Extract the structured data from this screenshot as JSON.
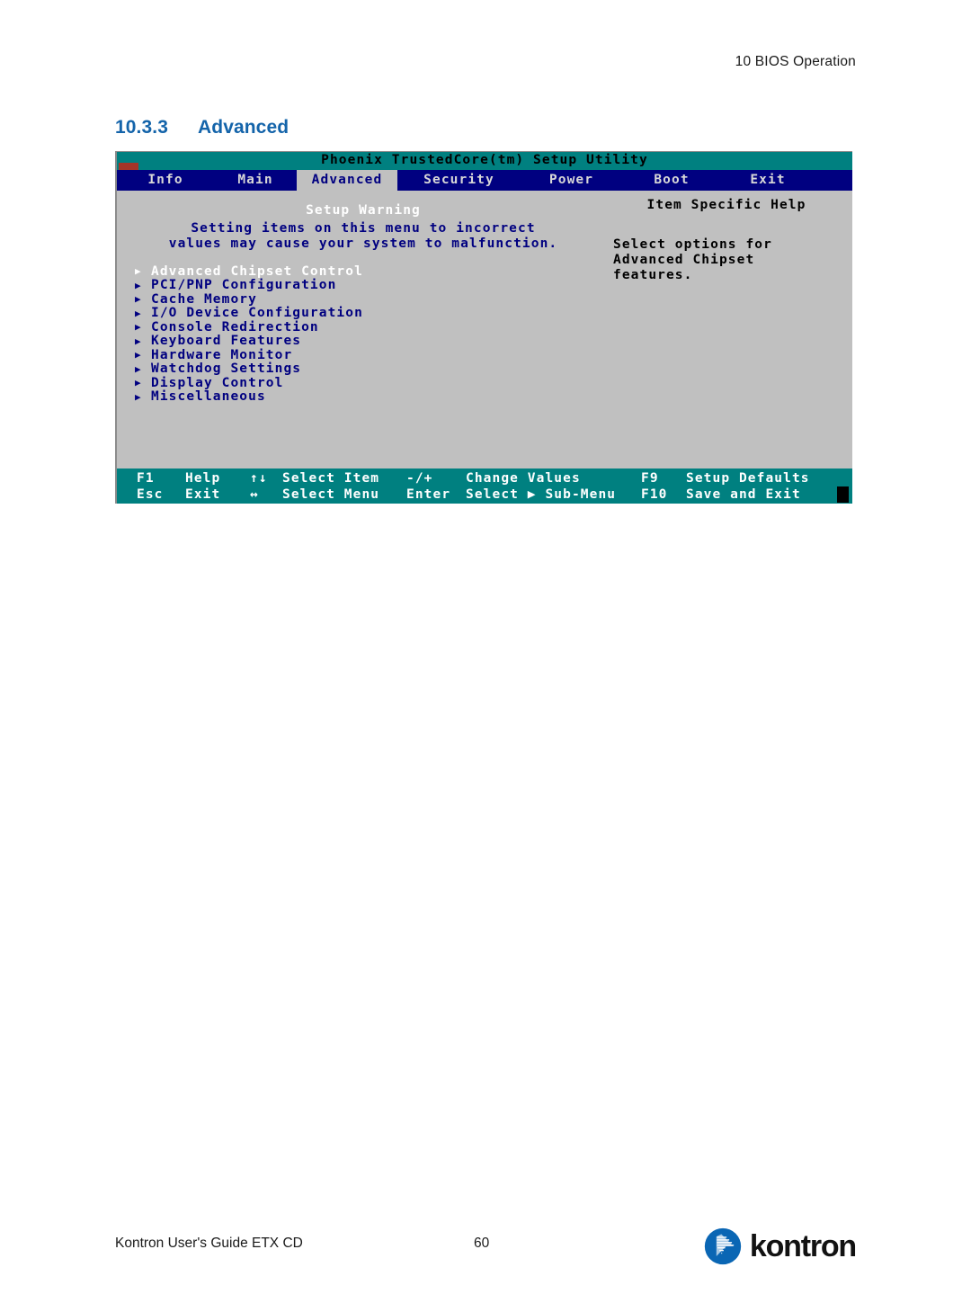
{
  "page": {
    "header": "10 BIOS Operation",
    "heading_number": "10.3.3",
    "heading_title": "Advanced",
    "footer_left": "Kontron User's Guide ETX CD",
    "footer_page": "60",
    "logo_word": "kontron",
    "colors": {
      "heading_blue": "#1464aa",
      "logo_blue": "#0a66b4",
      "bios_titlebar_teal": "#008080",
      "bios_menubar_blue": "#000080",
      "bios_background_gray": "#c0c0c0",
      "bios_text_blue": "#000080",
      "bios_selected_white": "#ffffff",
      "title_redmark": "#a33528"
    }
  },
  "bios": {
    "title": "Phoenix TrustedCore(tm) Setup Utility",
    "menubar": [
      {
        "label": "Info",
        "active": false
      },
      {
        "label": "Main",
        "active": false
      },
      {
        "label": "Advanced",
        "active": true
      },
      {
        "label": "Security",
        "active": false
      },
      {
        "label": "Power",
        "active": false
      },
      {
        "label": "Boot",
        "active": false
      },
      {
        "label": "Exit",
        "active": false
      }
    ],
    "warning": {
      "title": "Setup Warning",
      "line1": "Setting items on this menu to incorrect",
      "line2": "values may cause your system to malfunction."
    },
    "items": [
      {
        "label": "Advanced Chipset Control",
        "selected": true
      },
      {
        "label": "PCI/PNP Configuration",
        "selected": false
      },
      {
        "label": "Cache Memory",
        "selected": false
      },
      {
        "label": "I/O Device Configuration",
        "selected": false
      },
      {
        "label": "Console Redirection",
        "selected": false
      },
      {
        "label": "Keyboard Features",
        "selected": false
      },
      {
        "label": "Hardware Monitor",
        "selected": false
      },
      {
        "label": "Watchdog Settings",
        "selected": false
      },
      {
        "label": "Display Control",
        "selected": false
      },
      {
        "label": "Miscellaneous",
        "selected": false
      }
    ],
    "item_arrow": "▶",
    "help": {
      "title": "Item Specific Help",
      "line1": "Select options for",
      "line2": "Advanced Chipset",
      "line3": "features."
    },
    "status": {
      "row1": {
        "key1": "F1",
        "action1": "Help",
        "key2": "↑↓",
        "action2": "Select Item",
        "key3": "-/+",
        "action3": "Change Values",
        "key4": "F9",
        "action4": "Setup Defaults"
      },
      "row2": {
        "key1": "Esc",
        "action1": "Exit",
        "key2": "↔",
        "action2": "Select Menu",
        "key3": "Enter",
        "action3": "Select ▶ Sub-Menu",
        "key4": "F10",
        "action4": "Save and Exit"
      }
    }
  }
}
